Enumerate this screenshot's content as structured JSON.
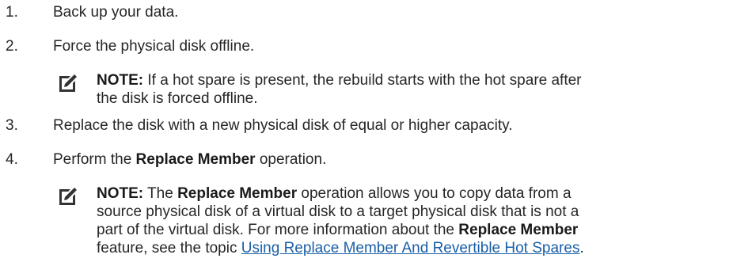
{
  "steps": [
    {
      "number": "1.",
      "text": "Back up your data."
    },
    {
      "number": "2.",
      "text": "Force the physical disk offline."
    },
    {
      "number": "3.",
      "text": "Replace the disk with a new physical disk of equal or higher capacity."
    },
    {
      "number": "4.",
      "pre": "Perform the ",
      "bold": "Replace Member",
      "post": " operation."
    }
  ],
  "note1": {
    "label": "NOTE:",
    "line1": " If a hot spare is present, the rebuild starts with the hot spare after",
    "line2": "the disk is forced offline."
  },
  "note2": {
    "label": "NOTE:",
    "l1_pre": " The ",
    "l1_bold": "Replace Member",
    "l1_post": " operation allows you to copy data from a",
    "line2": "source physical disk of a virtual disk to a target physical disk that is not a",
    "l3_pre": "part of the virtual disk. For more information about the ",
    "l3_bold": "Replace Member",
    "l4_pre": "feature, see the topic ",
    "l4_link": "Using Replace Member And Revertible Hot Spares",
    "l4_post": "."
  },
  "icons": {
    "note_icon": "pencil-note-icon"
  },
  "colors": {
    "text": "#262626",
    "link": "#1a5fa8"
  }
}
